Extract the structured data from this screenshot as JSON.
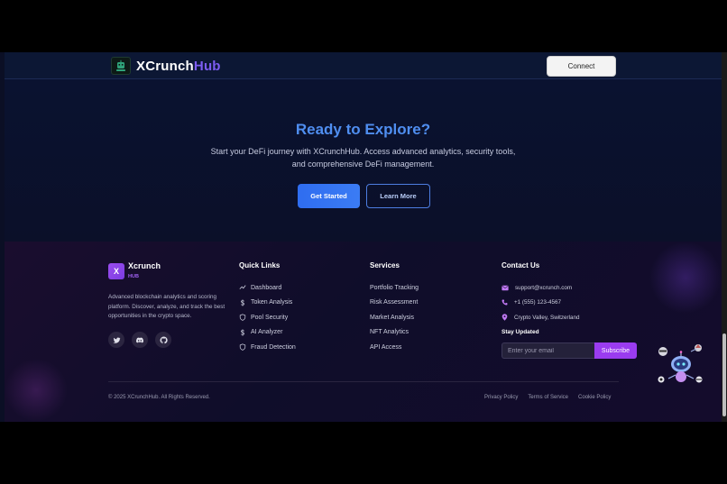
{
  "header": {
    "brand_main": "XCrunch",
    "brand_accent": "Hub",
    "connect_label": "Connect"
  },
  "hero": {
    "title": "Ready to Explore?",
    "description": "Start your DeFi journey with XCrunchHub. Access advanced analytics, security tools, and comprehensive DeFi management.",
    "primary_cta": "Get Started",
    "secondary_cta": "Learn More"
  },
  "footer": {
    "brand": {
      "mark": "X",
      "name": "Xcrunch",
      "sub": "HUB",
      "description": "Advanced blockchain analytics and scoring platform. Discover, analyze, and track the best opportunities in the crypto space.",
      "socials": [
        "twitter-icon",
        "discord-icon",
        "github-icon"
      ]
    },
    "quick_links": {
      "title": "Quick Links",
      "items": [
        {
          "label": "Dashboard",
          "icon": "trend-icon"
        },
        {
          "label": "Token Analysis",
          "icon": "dollar-icon"
        },
        {
          "label": "Pool Security",
          "icon": "shield-icon"
        },
        {
          "label": "AI Analyzer",
          "icon": "dollar-icon"
        },
        {
          "label": "Fraud Detection",
          "icon": "shield-icon"
        }
      ]
    },
    "services": {
      "title": "Services",
      "items": [
        "Portfolio Tracking",
        "Risk Assessment",
        "Market Analysis",
        "NFT Analytics",
        "API Access"
      ]
    },
    "contact": {
      "title": "Contact Us",
      "email": "support@xcrunch.com",
      "phone": "+1 (555) 123-4567",
      "location": "Crypto Valley, Switzerland",
      "stay_updated": "Stay Updated",
      "email_placeholder": "Enter your email",
      "subscribe_label": "Subscribe"
    },
    "copyright": "© 2025 XCrunchHub. All Rights Reserved.",
    "legal": [
      "Privacy Policy",
      "Terms of Service",
      "Cookie Policy"
    ]
  },
  "colors": {
    "accent_blue": "#4f8ef0",
    "accent_purple": "#9a3cf0",
    "background": "#0a0f26"
  }
}
